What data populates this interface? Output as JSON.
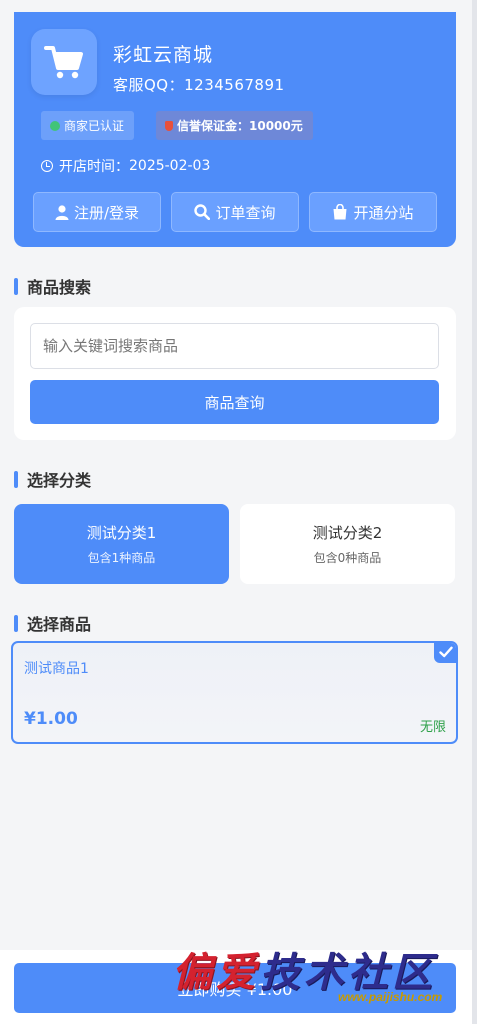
{
  "store": {
    "name": "彩虹云商城",
    "qq_label": "客服QQ：",
    "qq": "1234567891",
    "badge_verified": "商家已认证",
    "badge_deposit": "信誉保证金：10000元",
    "open_time_label": "开店时间：",
    "open_time": "2025-02-03",
    "logo_icon": "cart-icon"
  },
  "header_buttons": {
    "register": "注册/登录",
    "order": "订单查询",
    "branch": "开通分站"
  },
  "search": {
    "title": "商品搜索",
    "placeholder": "输入关键词搜索商品",
    "button": "商品查询"
  },
  "categories": {
    "title": "选择分类",
    "items": [
      {
        "name": "测试分类1",
        "count": "包含1种商品",
        "selected": true
      },
      {
        "name": "测试分类2",
        "count": "包含0种商品",
        "selected": false
      }
    ]
  },
  "products": {
    "title": "选择商品",
    "items": [
      {
        "name": "测试商品1",
        "price": "¥1.00",
        "stock": "无限",
        "selected": true
      }
    ]
  },
  "buy": {
    "button": "立即购买 ¥1.00"
  },
  "watermark": {
    "title": "偏爱技术社区",
    "url": "www.paijishu.com"
  },
  "colors": {
    "primary": "#4e8cf9",
    "background": "#f4f5f7",
    "stock_green": "#2fa14a"
  }
}
